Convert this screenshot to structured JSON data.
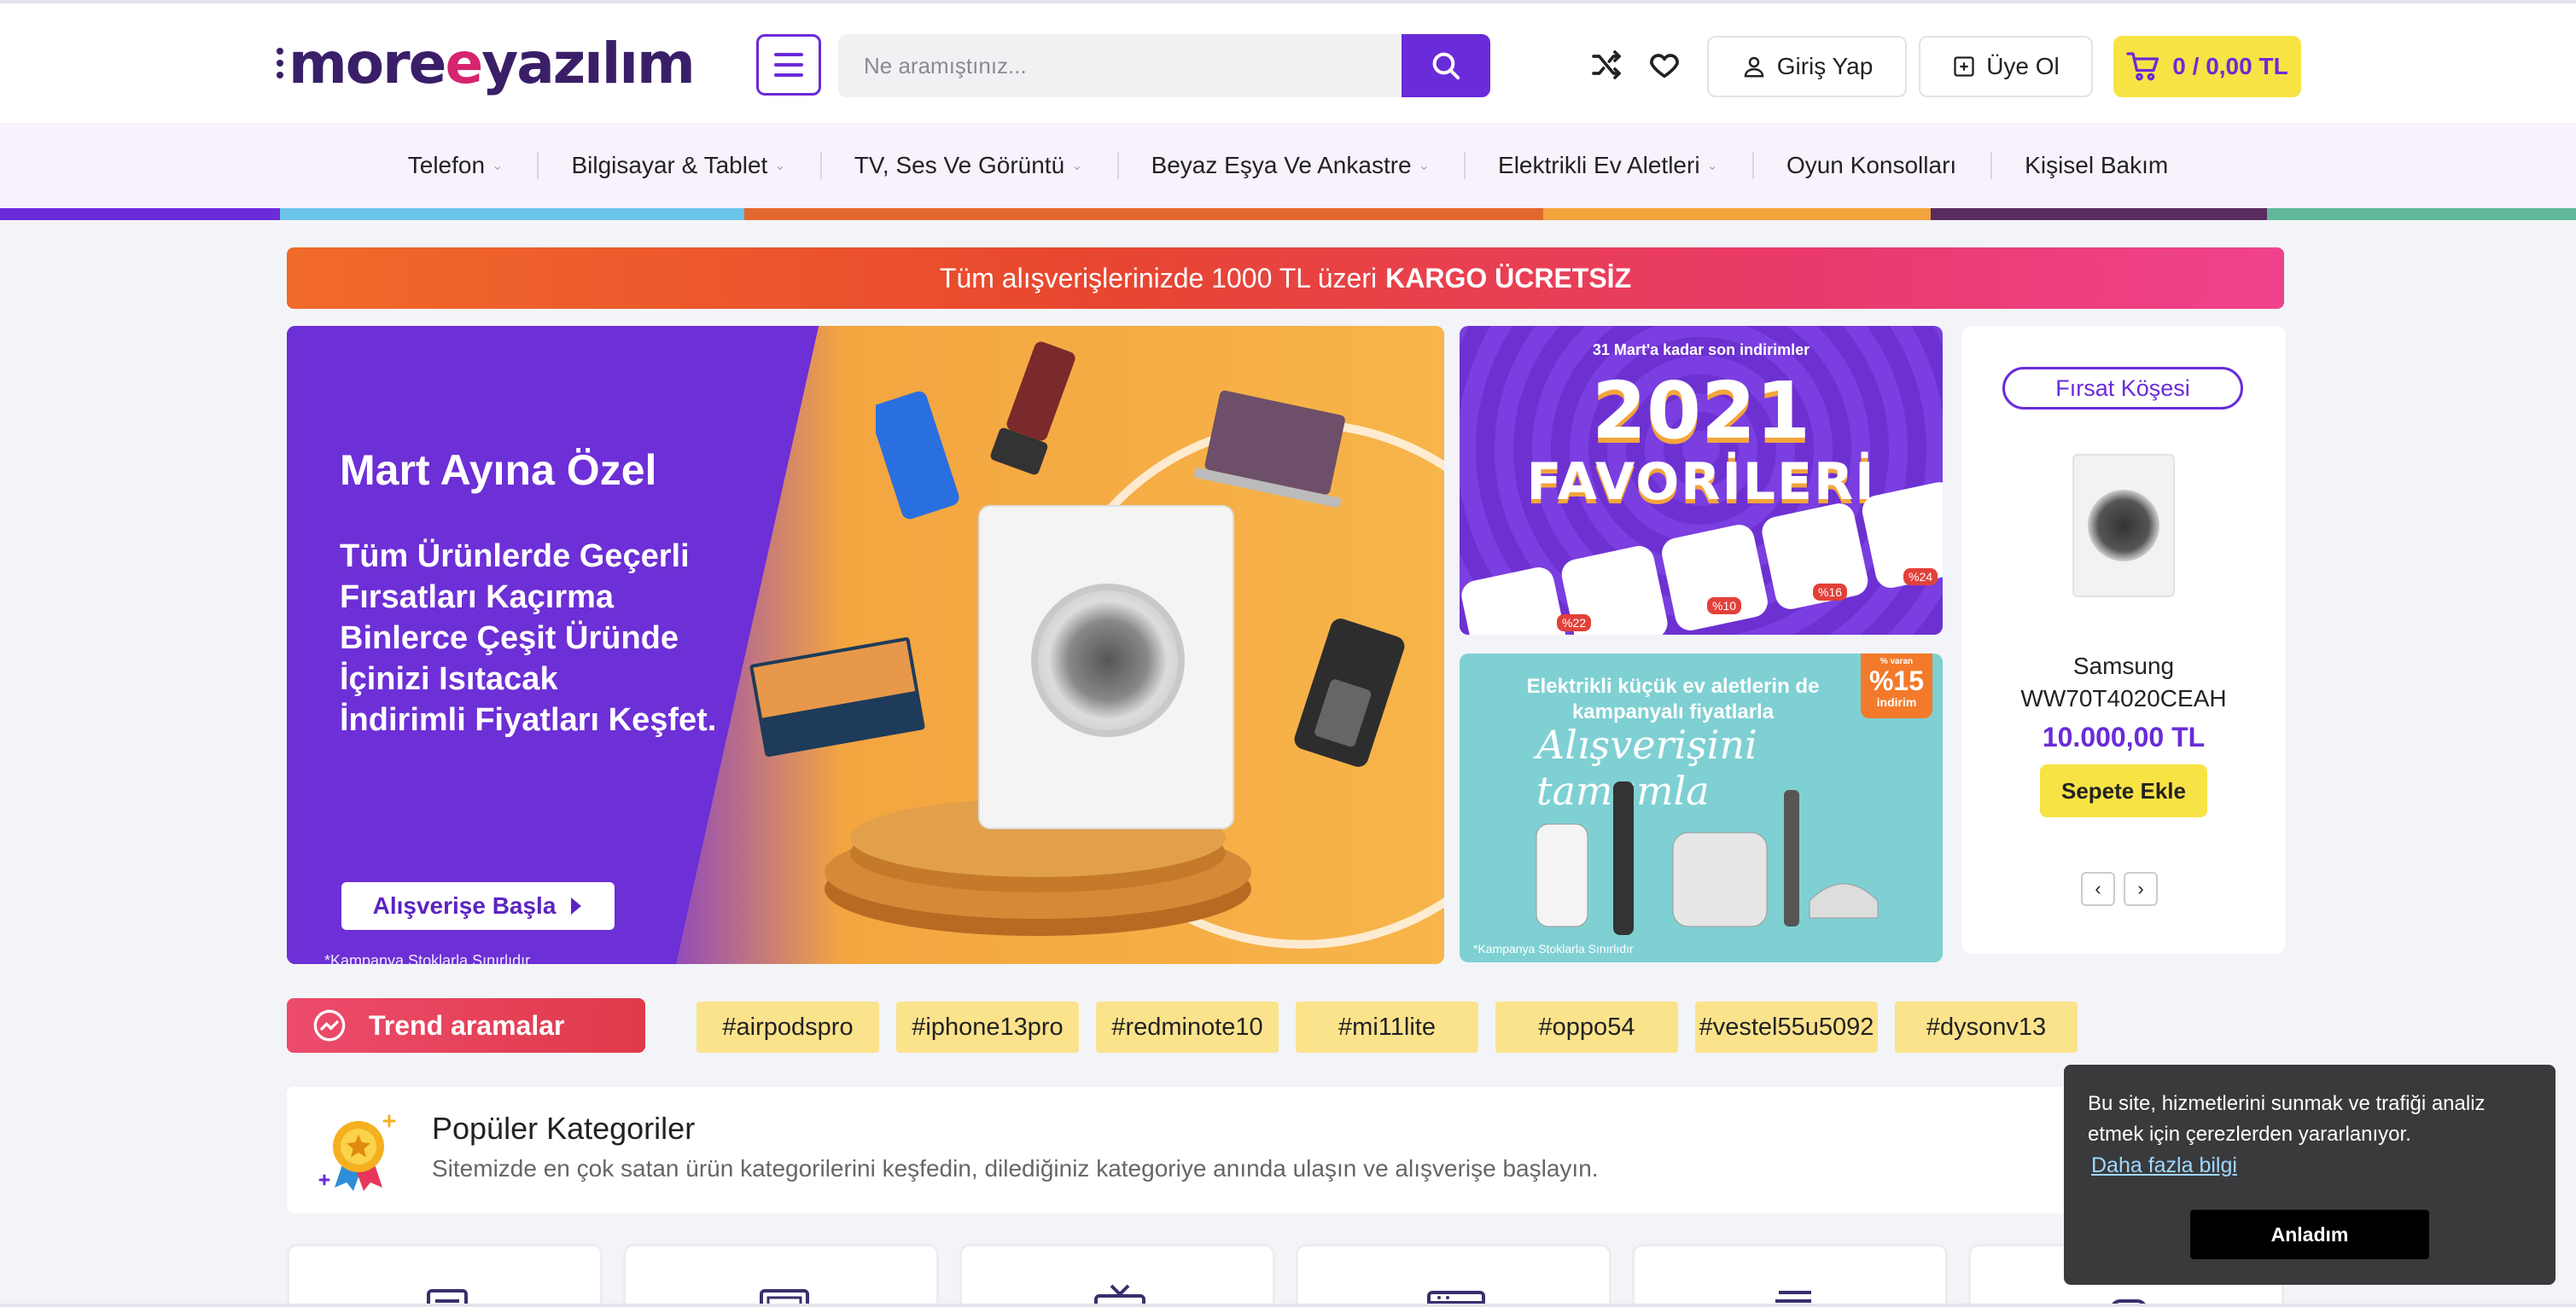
{
  "header": {
    "logo_prefix": "more",
    "logo_e": "e",
    "logo_suffix": "yazılım",
    "search_placeholder": "Ne aramıştınız...",
    "login_label": "Giriş Yap",
    "register_label": "Üye Ol",
    "cart_label": "0 / 0,00 TL"
  },
  "nav": {
    "items": [
      {
        "label": "Telefon"
      },
      {
        "label": "Bilgisayar & Tablet"
      },
      {
        "label": "TV, Ses Ve Görüntü"
      },
      {
        "label": "Beyaz Eşya Ve Ankastre"
      },
      {
        "label": "Elektrikli Ev Aletleri"
      },
      {
        "label": "Oyun Konsolları"
      },
      {
        "label": "Kişisel Bakım"
      }
    ],
    "color_bar": [
      "#6a2bd9",
      "#6cc3ea",
      "#e2692d",
      "#f2a43c",
      "#5a2b5e",
      "#5fb89a"
    ]
  },
  "promo": {
    "text": "Tüm alışverişlerinizde 1000 TL üzeri",
    "highlight": "KARGO ÜCRETSİZ"
  },
  "hero": {
    "title": "Mart Ayına Özel",
    "lines": [
      "Tüm Ürünlerde Geçerli",
      "Fırsatları Kaçırma",
      "Binlerce Çeşit Üründe",
      "İçinizi Isıtacak",
      "İndirimli Fiyatları Keşfet."
    ],
    "cta": "Alışverişe Başla",
    "note": "*Kampanya Stoklarla Sınırlıdır"
  },
  "banner1": {
    "small": "31 Mart'a kadar son indirimler",
    "year": "2021",
    "title": "FAVORİLERİ",
    "discounts": [
      "%22",
      "%10",
      "%16",
      "%24"
    ]
  },
  "banner2": {
    "text": "Elektrikli küçük ev aletlerin de kampanyalı fiyatlarla",
    "script": "Alışverişini tamamla",
    "badge_top": "% varan",
    "badge_pct": "%15",
    "badge_bottom": "indirim",
    "note": "*Kampanya Stoklarla Sınırlıdır"
  },
  "deal": {
    "tag": "Fırsat Köşesi",
    "brand": "Samsung",
    "model": "WW70T4020CEAH",
    "price": "10.000,00 TL",
    "add_label": "Sepete Ekle"
  },
  "trend": {
    "label": "Trend aramalar",
    "tags": [
      "#airpodspro",
      "#iphone13pro",
      "#redminote10",
      "#mi11lite",
      "#oppo54",
      "#vestel55u5092",
      "#dysonv13"
    ]
  },
  "popular": {
    "title": "Popüler Kategoriler",
    "desc": "Sitemizde en çok satan ürün kategorilerini keşfedin, dilediğiniz kategoriye anında ulaşın ve alışverişe başlayın."
  },
  "cookie": {
    "text": "Bu site, hizmetlerini sunmak ve trafiği analiz etmek için çerezlerden yararlanıyor.",
    "link": "Daha fazla bilgi",
    "button": "Anladım"
  },
  "colors": {
    "accent": "#6a2bd9",
    "yellow": "#f8e345",
    "logo": "#3a1f68",
    "logo_e": "#d4256e"
  }
}
